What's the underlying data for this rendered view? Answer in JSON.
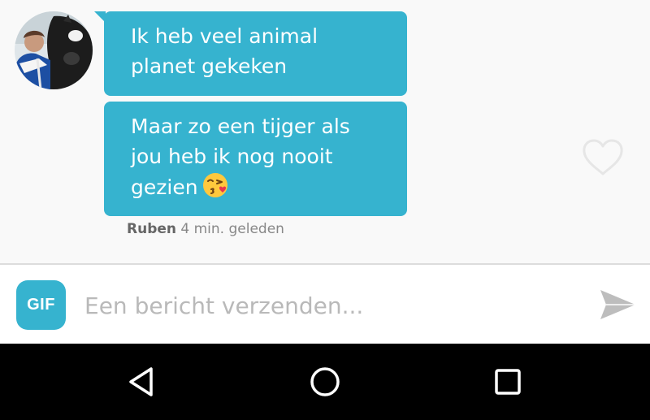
{
  "colors": {
    "accent": "#36b3cf",
    "chat_background": "#f9f9f9",
    "nav_bar": "#000000"
  },
  "conversation": {
    "messages": [
      {
        "lines": [
          "Ik heb veel animal",
          "planet gekeken"
        ]
      },
      {
        "lines": [
          "Maar zo een tijger als",
          "jou heb ik nog nooit",
          "gezien"
        ],
        "emoji": "face-blowing-kiss"
      }
    ],
    "meta": {
      "sender": "Ruben",
      "time": "4 min. geleden"
    },
    "avatar_icon": "profile-photo",
    "like_icon": "heart-outline-icon"
  },
  "composer": {
    "gif_label": "GIF",
    "placeholder": "Een bericht verzenden...",
    "value": "",
    "send_icon": "send-arrow-icon"
  },
  "navigation": {
    "back_icon": "triangle-back-icon",
    "home_icon": "circle-home-icon",
    "recents_icon": "square-recents-icon"
  }
}
